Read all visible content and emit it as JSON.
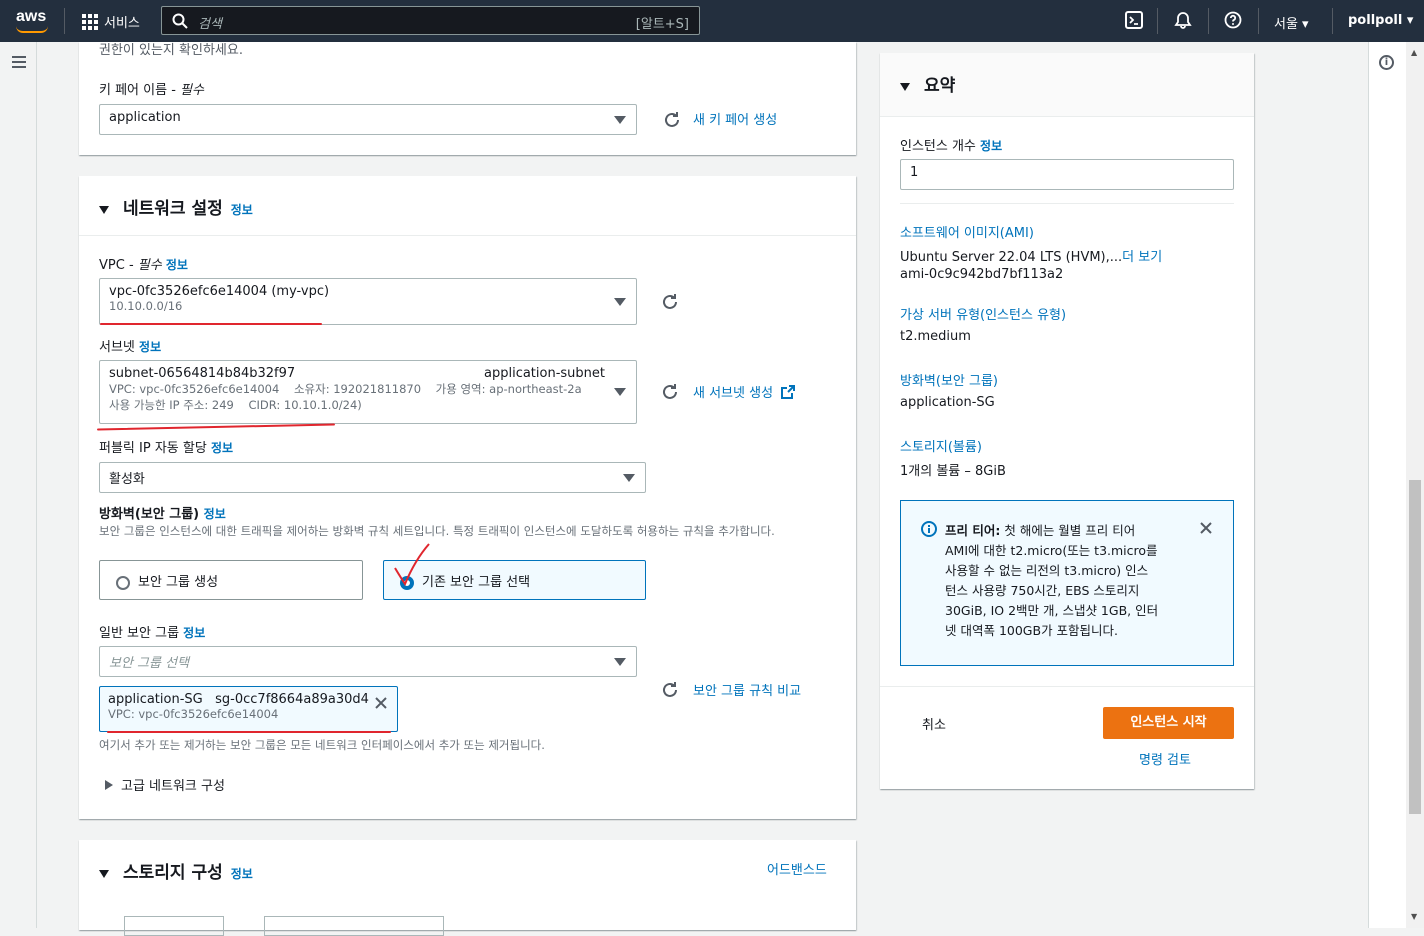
{
  "topnav": {
    "logo": "aws",
    "services": "서비스",
    "search_placeholder": "검색",
    "search_shortcut": "[알트+S]",
    "region": "서울",
    "user": "pollpoll",
    "icons": [
      "cloudshell-icon",
      "bell-icon",
      "help-icon"
    ]
  },
  "keypair": {
    "partial_text": "권한이 있는지 확인하세요.",
    "label": "키 페어 이름 -",
    "required": "필수",
    "value": "application",
    "create_link": "새 키 페어 생성"
  },
  "network": {
    "title": "네트워크 설정",
    "info": "정보",
    "vpc": {
      "label": "VPC -",
      "required": "필수",
      "info": "정보",
      "value": "vpc-0fc3526efc6e14004 (my-vpc)",
      "cidr": "10.10.0.0/16"
    },
    "subnet": {
      "label": "서브넷",
      "info": "정보",
      "id": "subnet-06564814b84b32f97",
      "name": "application-subnet",
      "vpc": "VPC: vpc-0fc3526efc6e14004",
      "owner": "소유자: 192021811870",
      "az": "가용 영역: ap-northeast-2a",
      "ips": "사용 가능한 IP 주소: 249",
      "cidr": "CIDR: 10.10.1.0/24)",
      "create_link": "새 서브넷 생성"
    },
    "public_ip": {
      "label": "퍼블릭 IP 자동 할당",
      "info": "정보",
      "value": "활성화"
    },
    "firewall": {
      "label": "방화벽(보안 그룹)",
      "info": "정보",
      "desc": "보안 그룹은 인스턴스에 대한 트래픽을 제어하는 방화벽 규칙 세트입니다. 특정 트래픽이 인스턴스에 도달하도록 허용하는 규칙을 추가합니다.",
      "option_create": "보안 그룹 생성",
      "option_existing": "기존 보안 그룹 선택",
      "selected": "option_existing"
    },
    "sg": {
      "label": "일반 보안 그룹",
      "info": "정보",
      "placeholder": "보안 그룹 선택",
      "chip_name": "application-SG",
      "chip_id": "sg-0cc7f8664a89a30d4",
      "chip_vpc": "VPC: vpc-0fc3526efc6e14004",
      "compare_link": "보안 그룹 규칙 비교",
      "note": "여기서 추가 또는 제거하는 보안 그룹은 모든 네트워크 인터페이스에서 추가 또는 제거됩니다."
    },
    "advanced": "고급 네트워크 구성"
  },
  "storage": {
    "title": "스토리지 구성",
    "info": "정보",
    "advanced_link": "어드밴스드"
  },
  "summary": {
    "title": "요약",
    "count_label": "인스턴스 개수",
    "count_info": "정보",
    "count_value": "1",
    "ami_key": "소프트웨어 이미지(AMI)",
    "ami_value": "Ubuntu Server 22.04 LTS (HVM),...",
    "ami_more": "더 보기",
    "ami_id": "ami-0c9c942bd7bf113a2",
    "type_key": "가상 서버 유형(인스턴스 유형)",
    "type_value": "t2.medium",
    "fw_key": "방화벽(보안 그룹)",
    "fw_value": "application-SG",
    "storage_key": "스토리지(볼륨)",
    "storage_value": "1개의 볼륨 – 8GiB",
    "freetier_title": "프리 티어:",
    "freetier_lines": [
      "첫 해에는 월별 프리 티어",
      "AMI에 대한 t2.micro(또는 t3.micro를",
      "사용할 수 없는 리전의 t3.micro) 인스",
      "턴스 사용량 750시간, EBS 스토리지",
      "30GiB, IO 2백만 개, 스냅샷 1GB, 인터",
      "넷 대역폭 100GB가 포함됩니다."
    ],
    "cancel": "취소",
    "launch": "인스턴스 시작",
    "review": "명령 검토"
  },
  "colors": {
    "nav": "#232f3e",
    "link": "#0073bb",
    "primary": "#ec7211",
    "annotation": "#e0262e"
  }
}
